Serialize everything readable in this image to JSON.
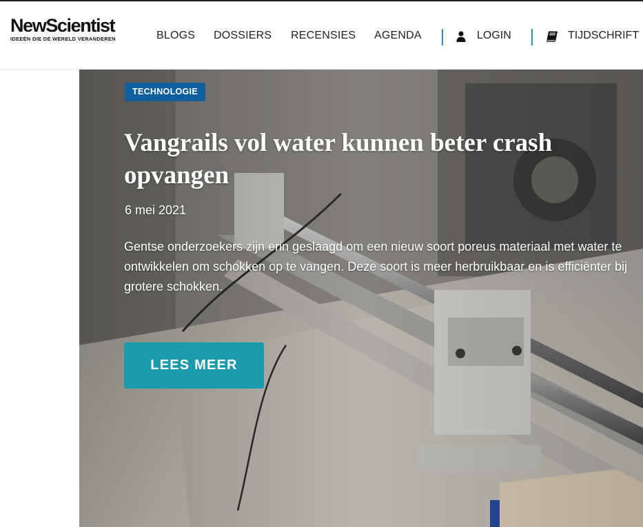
{
  "logo": {
    "name": "NewScientist",
    "tagline": "IDEEËN DIE DE WERELD VERANDEREN"
  },
  "nav": {
    "items": [
      {
        "label": "BLOGS"
      },
      {
        "label": "DOSSIERS"
      },
      {
        "label": "RECENSIES"
      },
      {
        "label": "AGENDA"
      }
    ],
    "login_label": "LOGIN",
    "magazine_label": "TIJDSCHRIFT",
    "icons": {
      "login": "user-icon",
      "magazine": "book-icon"
    }
  },
  "article": {
    "category": "TECHNOLOGIE",
    "title": "Vangrails vol water kunnen beter crash opvangen",
    "date": "6 mei 2021",
    "summary": "Gentse onderzoekers zijn erin geslaagd om een nieuw soort poreus materiaal met water te ontwikkelen om schokken op te vangen. Deze soort is meer herbruikbaar en is efficiënter bij grotere schokken.",
    "cta_label": "LEES MEER"
  },
  "colors": {
    "accent": "#1a9aaa",
    "divider": "#1f9ab0",
    "badge": "#0e5f9c",
    "text": "#222222"
  }
}
